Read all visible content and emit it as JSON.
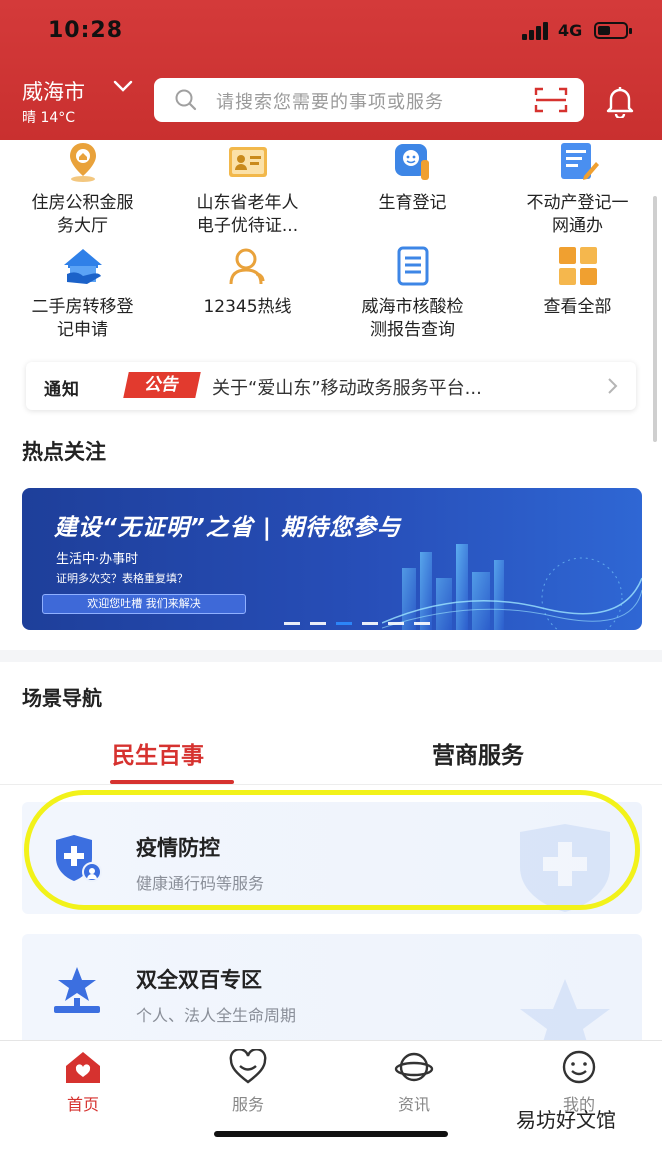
{
  "status": {
    "time": "10:28",
    "network": "4G"
  },
  "header": {
    "city": "威海市",
    "weather": "晴 14°C",
    "search_placeholder": "请搜索您需要的事项或服务"
  },
  "colors": {
    "brand_red": "#d6322f",
    "header_red": "#cf3634",
    "banner_blue": "#274eb8",
    "highlight_yellow": "#f2f21a"
  },
  "services": [
    {
      "label_1": "住房公积金服",
      "label_2": "务大厅",
      "icon": "housing-fund-icon"
    },
    {
      "label_1": "山东省老年人",
      "label_2": "电子优待证...",
      "icon": "senior-card-icon"
    },
    {
      "label_1": "生育登记",
      "label_2": "",
      "icon": "birth-registration-icon"
    },
    {
      "label_1": "不动产登记一",
      "label_2": "网通办",
      "icon": "real-estate-icon"
    },
    {
      "label_1": "二手房转移登",
      "label_2": "记申请",
      "icon": "house-transfer-icon"
    },
    {
      "label_1": "12345热线",
      "label_2": "",
      "icon": "hotline-icon"
    },
    {
      "label_1": "威海市核酸检",
      "label_2": "测报告查询",
      "icon": "test-report-icon"
    },
    {
      "label_1": "查看全部",
      "label_2": "",
      "icon": "view-all-icon"
    }
  ],
  "notice": {
    "tag1": "通知",
    "tag2": "公告",
    "text": "关于“爱山东”移动政务服务平台..."
  },
  "hot": {
    "title": "热点关注",
    "banner_title": "建设“无证明”之省 | 期待您参与",
    "banner_sub": "生活中·办事时",
    "banner_q": "证明多次交？表格重复填？",
    "banner_btn": "欢迎您吐槽 我们来解决"
  },
  "scene": {
    "title": "场景导航",
    "tabs": [
      "民生百事",
      "营商服务"
    ],
    "cards": [
      {
        "title": "疫情防控",
        "sub": "健康通行码等服务",
        "icon": "shield-plus-icon"
      },
      {
        "title": "双全双百专区",
        "sub": "个人、法人全生命周期",
        "icon": "star-person-icon"
      }
    ]
  },
  "nav": [
    "首页",
    "服务",
    "资讯",
    "我的"
  ],
  "watermark": "易坊好文馆"
}
